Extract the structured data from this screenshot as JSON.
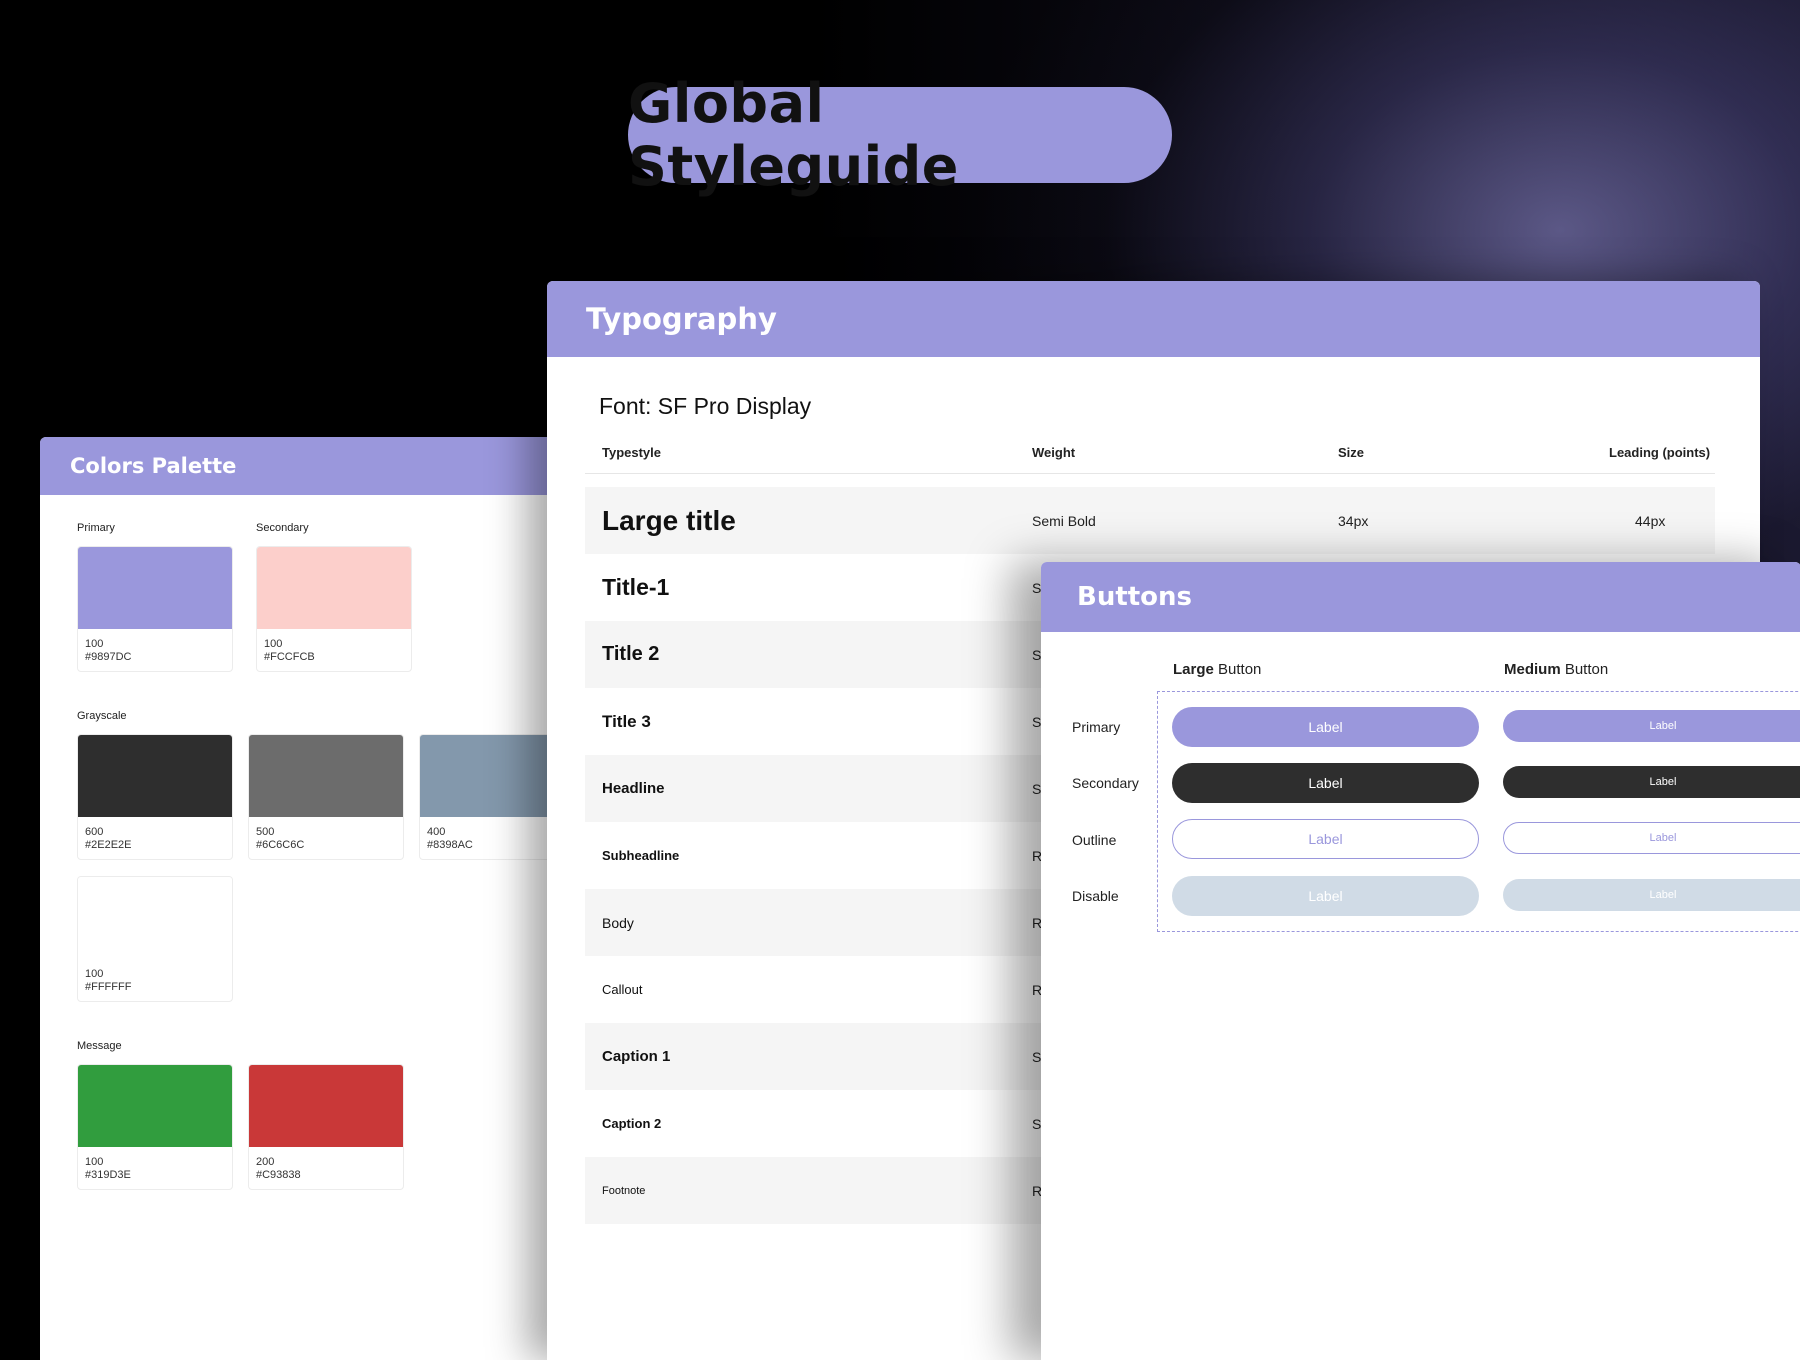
{
  "page_title": "Global Styleguide",
  "colors_card": {
    "title": "Colors Palette",
    "primary": {
      "label": "Primary",
      "level": "100",
      "hex": "#9897DC",
      "color": "#9a97dc"
    },
    "secondary": {
      "label": "Secondary",
      "level": "100",
      "hex": "#FCCFCB",
      "color": "#fccfcb"
    },
    "grayscale_label": "Grayscale",
    "grayscale": [
      {
        "level": "600",
        "hex": "#2E2E2E",
        "color": "#2e2e2e"
      },
      {
        "level": "500",
        "hex": "#6C6C6C",
        "color": "#6c6c6c"
      },
      {
        "level": "400",
        "hex": "#8398AC",
        "color": "#8398ac"
      },
      {
        "level": "100",
        "hex": "#FFFFFF",
        "color": "#ffffff"
      }
    ],
    "message_label": "Message",
    "message": [
      {
        "level": "100",
        "hex": "#319D3E",
        "color": "#319d3e"
      },
      {
        "level": "200",
        "hex": "#C93838",
        "color": "#c93838"
      }
    ]
  },
  "typography_card": {
    "title": "Typography",
    "font": "Font: SF Pro Display",
    "columns": [
      "Typestyle",
      "Weight",
      "Size",
      "Leading (points)"
    ],
    "rows": [
      {
        "name": "Large title",
        "weight": "Semi Bold",
        "size": "34px",
        "leading": "44px"
      },
      {
        "name": "Title-1",
        "weight": "S"
      },
      {
        "name": "Title 2",
        "weight": "S"
      },
      {
        "name": "Title 3",
        "weight": "S"
      },
      {
        "name": "Headline",
        "weight": "S"
      },
      {
        "name": "Subheadline",
        "weight": "R"
      },
      {
        "name": "Body",
        "weight": "R"
      },
      {
        "name": "Callout",
        "weight": "R"
      },
      {
        "name": "Caption 1",
        "weight": "S"
      },
      {
        "name": "Caption 2",
        "weight": "S"
      },
      {
        "name": "Footnote",
        "weight": "R"
      }
    ]
  },
  "buttons_card": {
    "title": "Buttons",
    "col_large": {
      "bold": "Large",
      "rest": " Button"
    },
    "col_medium": {
      "bold": "Medium",
      "rest": " Button"
    },
    "row_labels": [
      "Primary",
      "Secondary",
      "Outline",
      "Disable"
    ],
    "button_label": "Label"
  }
}
